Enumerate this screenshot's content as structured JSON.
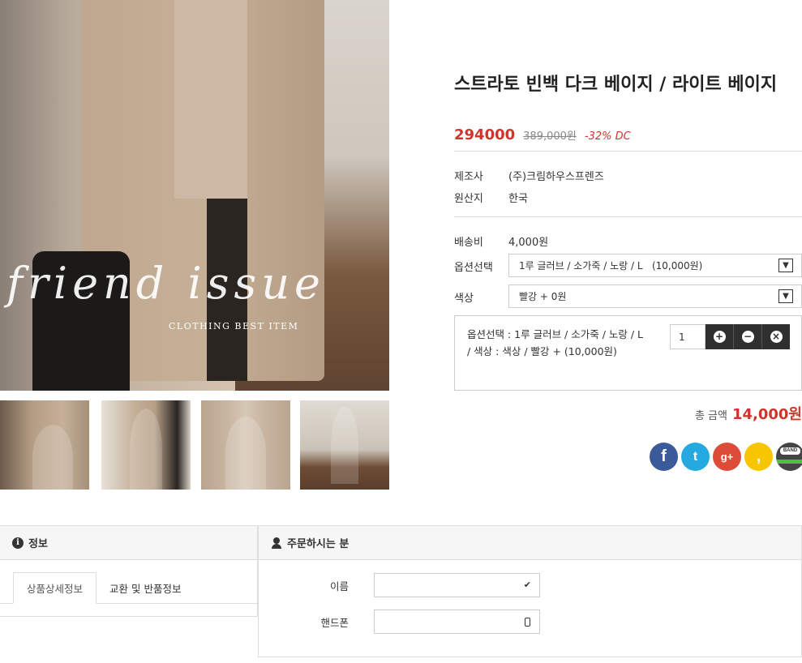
{
  "gallery": {
    "main_script_text": "friend issue",
    "main_caption": "CLOTHING BEST ITEM",
    "thumbnails": [
      "thumb-1",
      "thumb-2",
      "thumb-3",
      "thumb-4"
    ]
  },
  "product": {
    "title": "스트라토 빈백 다크 베이지 / 라이트 베이지",
    "price": "294000",
    "old_price": "389,000원",
    "discount": "-32% DC",
    "info": [
      {
        "label": "제조사",
        "value": "(주)크림하우스프렌즈"
      },
      {
        "label": "원산지",
        "value": "한국"
      }
    ],
    "shipping_label": "배송비",
    "shipping_value": "4,000원",
    "option_label": "옵션선택",
    "option_value": "1루 글러브 / 소가죽 / 노랑 / L   (10,000원)",
    "color_label": "색상",
    "color_value": "빨강 + 0원",
    "selected_option_text": "옵션선택 : 1루 글러브 / 소가죽 / 노랑 / L / 색상 : 색상 / 빨강 + (10,000원)",
    "quantity": "1",
    "total_label": "총 금액",
    "total_value": "14,000원"
  },
  "social": {
    "facebook": "f",
    "twitter": "t",
    "googleplus": "g+",
    "kakaostory": ",",
    "band": "BAND"
  },
  "info_panel": {
    "title": "정보",
    "tabs": [
      "상품상세정보",
      "교환 및 반품정보"
    ],
    "active_tab": 0
  },
  "order_panel": {
    "title": "주문하시는 분",
    "name_label": "이름",
    "phone_label": "핸드폰",
    "name_value": "",
    "phone_value": ""
  },
  "colors": {
    "accent": "#d0342c",
    "dark_button": "#2f2f2f"
  }
}
